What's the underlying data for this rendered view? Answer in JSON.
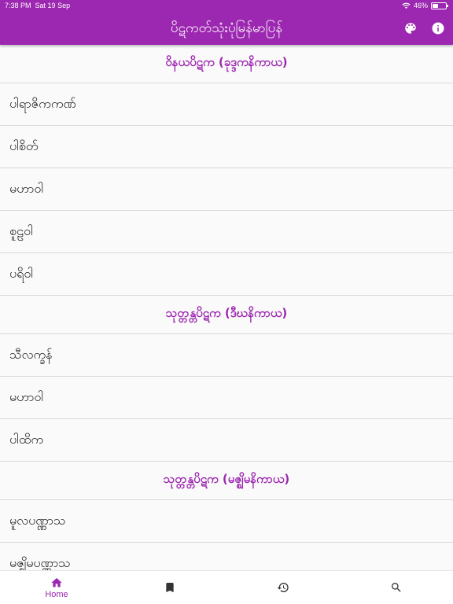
{
  "status": {
    "time": "7:38 PM",
    "date": "Sat 19 Sep",
    "battery": "46%",
    "battery_level": 0.46
  },
  "app_bar": {
    "title": "ပိဋကတ်သုံးပုံမြန်မာပြန်",
    "palette_icon": "palette-icon",
    "info_icon": "info-icon"
  },
  "sections": [
    {
      "header": "ဝိနယပိဋက (ခုဒ္ဒကနိကာယ)",
      "items": [
        "ပါရာဇိကကဏ်",
        "ပါစိတ်",
        "မဟာဝါ",
        "စူဠဝါ",
        "ပရိဝါ"
      ]
    },
    {
      "header": "သုတ္တန္တပိဋက (ဒီဃနိကာယ)",
      "items": [
        "သီလက္ခန်",
        "မဟာဝါ",
        "ပါထိက"
      ]
    },
    {
      "header": "သုတ္တန္တပိဋက (မဇ္ဈိမနိကာယ)",
      "items": [
        "မူလပဏ္ဏာသ",
        "မဇ္ဈိမပဏ္ဏာသ"
      ]
    }
  ],
  "bottom_nav": {
    "home_label": "Home",
    "items": [
      "home-icon",
      "bookmark-icon",
      "history-icon",
      "search-icon"
    ]
  },
  "colors": {
    "primary": "#9c27b0",
    "divider": "#d9d9d9"
  }
}
